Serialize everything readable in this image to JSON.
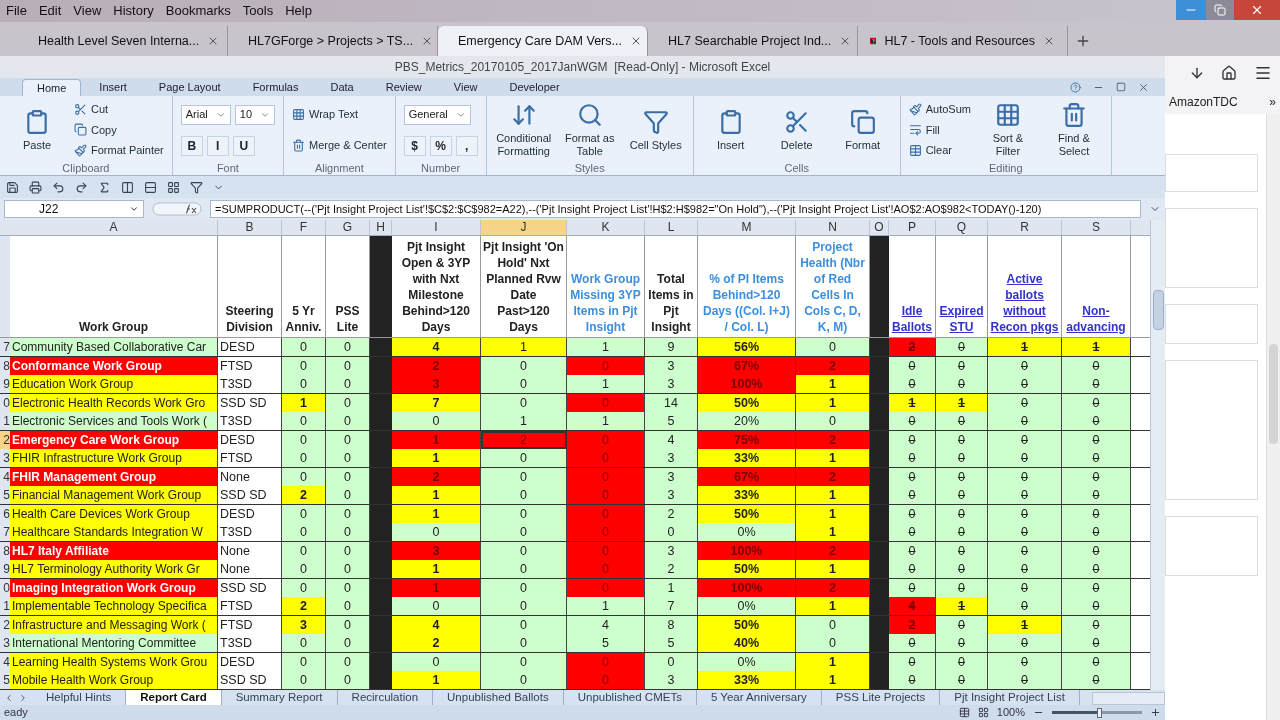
{
  "browser": {
    "menu": [
      "File",
      "Edit",
      "View",
      "History",
      "Bookmarks",
      "Tools",
      "Help"
    ],
    "tabs": [
      {
        "title": "Health Level Seven Interna...",
        "selected": false
      },
      {
        "title": "HL7GForge > Projects > TS...",
        "selected": false
      },
      {
        "title": "Emergency Care DAM Vers...",
        "selected": true
      },
      {
        "title": "HL7 Searchable Project Ind...",
        "selected": false
      },
      {
        "title": "HL7 - Tools and Resources",
        "selected": false
      }
    ],
    "bookmarks": [
      "AmazonTDC",
      "»"
    ]
  },
  "excel": {
    "title": "PBS_Metrics_20170105_2017JanWGM  [Read-Only] - Microsoft Excel",
    "ribbon_tabs": [
      {
        "label": "Home",
        "selected": true
      },
      {
        "label": "Insert",
        "selected": false
      },
      {
        "label": "Page Layout",
        "selected": false
      },
      {
        "label": "Formulas",
        "selected": false
      },
      {
        "label": "Data",
        "selected": false
      },
      {
        "label": "Review",
        "selected": false
      },
      {
        "label": "View",
        "selected": false
      },
      {
        "label": "Developer",
        "selected": false
      }
    ],
    "ribbon_groups": [
      {
        "name": "Clipboard",
        "stacks": [
          [
            [
              {
                "kind": "large",
                "label": "Paste"
              }
            ]
          ],
          [
            [
              {
                "kind": "small",
                "label": "Cut"
              }
            ],
            [
              {
                "kind": "small",
                "label": "Copy"
              }
            ],
            [
              {
                "kind": "small",
                "label": "Format Painter"
              }
            ]
          ]
        ]
      },
      {
        "name": "Font",
        "stacks": [
          [
            [
              {
                "kind": "field",
                "label": "Arial"
              },
              {
                "kind": "field",
                "label": "10"
              }
            ],
            [
              {
                "kind": "glyph",
                "label": "B"
              },
              {
                "kind": "glyph",
                "label": "I"
              },
              {
                "kind": "glyph",
                "label": "U"
              }
            ]
          ]
        ]
      },
      {
        "name": "Alignment",
        "stacks": [
          [
            [
              {
                "kind": "small",
                "label": "Wrap Text"
              }
            ],
            [
              {
                "kind": "small",
                "label": "Merge & Center"
              }
            ]
          ]
        ]
      },
      {
        "name": "Number",
        "stacks": [
          [
            [
              {
                "kind": "field",
                "label": "General"
              }
            ],
            [
              {
                "kind": "glyph",
                "label": "$"
              },
              {
                "kind": "glyph",
                "label": "%"
              },
              {
                "kind": "glyph",
                "label": ","
              }
            ]
          ]
        ]
      },
      {
        "name": "Styles",
        "stacks": [
          [
            [
              {
                "kind": "large",
                "label": "Conditional Formatting"
              }
            ]
          ],
          [
            [
              {
                "kind": "large",
                "label": "Format as Table"
              }
            ]
          ],
          [
            [
              {
                "kind": "large",
                "label": "Cell Styles"
              }
            ]
          ]
        ]
      },
      {
        "name": "Cells",
        "stacks": [
          [
            [
              {
                "kind": "large",
                "label": "Insert"
              }
            ]
          ],
          [
            [
              {
                "kind": "large",
                "label": "Delete"
              }
            ]
          ],
          [
            [
              {
                "kind": "large",
                "label": "Format"
              }
            ]
          ]
        ]
      },
      {
        "name": "Editing",
        "stacks": [
          [
            [
              {
                "kind": "small",
                "label": "AutoSum"
              }
            ],
            [
              {
                "kind": "small",
                "label": "Fill"
              }
            ],
            [
              {
                "kind": "small",
                "label": "Clear"
              }
            ]
          ],
          [
            [
              {
                "kind": "large",
                "label": "Sort & Filter"
              }
            ]
          ],
          [
            [
              {
                "kind": "large",
                "label": "Find & Select"
              }
            ]
          ]
        ]
      }
    ],
    "name_box": "J22",
    "formula": "=SUMPRODUCT(--('Pjt Insight Project List'!$C$2:$C$982=A22),--('Pjt Insight Project List'!H$2:H$982=\"On Hold\"),--('Pjt Insight Project List'!AO$2:AO$982<TODAY()-120)",
    "columns": [
      {
        "letter": "A",
        "heading": "Work Group",
        "kind": "plain",
        "selected": false
      },
      {
        "letter": "B",
        "heading": "Steering Division",
        "kind": "plain",
        "selected": false
      },
      {
        "letter": "F",
        "heading": "5 Yr Anniv.",
        "kind": "plain",
        "selected": false
      },
      {
        "letter": "G",
        "heading": "PSS Lite",
        "kind": "plain",
        "selected": false
      },
      {
        "letter": "H",
        "kind": "separator",
        "selected": false
      },
      {
        "letter": "I",
        "heading": "Pjt Insight Open & 3YP with Nxt Milestone Behind>120 Days",
        "kind": "plain",
        "selected": false
      },
      {
        "letter": "J",
        "heading": "Pjt Insight 'On Hold' Nxt Planned Rvw Date Past>120 Days",
        "kind": "plain",
        "selected": true
      },
      {
        "letter": "K",
        "heading": "Work Group Missing 3YP Items in Pjt Insight",
        "kind": "blue",
        "selected": false
      },
      {
        "letter": "L",
        "heading": "Total Items in Pjt Insight",
        "kind": "plain",
        "selected": false
      },
      {
        "letter": "M",
        "heading": "% of PI Items Behind>120 Days ((Col. I+J) / Col. L)",
        "kind": "blue",
        "selected": false
      },
      {
        "letter": "N",
        "heading": "Project Health (Nbr of Red Cells In Cols C, D, K, M)",
        "kind": "blue",
        "selected": false
      },
      {
        "letter": "O",
        "kind": "separator",
        "selected": false
      },
      {
        "letter": "P",
        "heading": "Idle Ballots",
        "kind": "struck",
        "selected": false
      },
      {
        "letter": "Q",
        "heading": "Expired STU",
        "kind": "struck",
        "selected": false
      },
      {
        "letter": "R",
        "heading": "Active ballots without Recon pkgs",
        "kind": "struck",
        "selected": false
      },
      {
        "letter": "S",
        "heading": "Non-advancing",
        "kind": "struck",
        "selected": false
      }
    ],
    "rows": [
      {
        "row": "7",
        "selected": false,
        "cells": [
          {
            "text": "Community Based Collaborative Car",
            "color": "#ccffcc"
          },
          {
            "text": "DESD",
            "color": "#ffffff"
          },
          {
            "text": "0",
            "color": "#ccffcc"
          },
          {
            "text": "0",
            "color": "#ccffcc"
          },
          {
            "color": "#222222"
          },
          {
            "text": "4",
            "color": "#ffff00"
          },
          {
            "text": "1",
            "color": "#ffff00"
          },
          {
            "text": "1",
            "color": "#ccffcc"
          },
          {
            "text": "9",
            "color": "#ccffcc"
          },
          {
            "text": "56%",
            "color": "#ffff00"
          },
          {
            "text": "0",
            "color": "#ccffcc"
          },
          {
            "color": "#222222"
          },
          {
            "text": "2",
            "color": "#ff0000"
          },
          {
            "text": "0",
            "color": "#ccffcc"
          },
          {
            "text": "1",
            "color": "#ffff00"
          },
          {
            "text": "1",
            "color": "#ffff00"
          }
        ]
      },
      {
        "row": "8",
        "selected": false,
        "cells": [
          {
            "text": "Conformance Work Group",
            "color": "#ff0000"
          },
          {
            "text": "FTSD",
            "color": "#ffffff"
          },
          {
            "text": "0",
            "color": "#ccffcc"
          },
          {
            "text": "0",
            "color": "#ccffcc"
          },
          {
            "color": "#222222"
          },
          {
            "text": "2",
            "color": "#ff0000"
          },
          {
            "text": "0",
            "color": "#ccffcc"
          },
          {
            "text": "0",
            "color": "#ff0000"
          },
          {
            "text": "3",
            "color": "#ccffcc"
          },
          {
            "text": "67%",
            "color": "#ff0000"
          },
          {
            "text": "2",
            "color": "#ff0000"
          },
          {
            "color": "#222222"
          },
          {
            "text": "0",
            "color": "#ccffcc"
          },
          {
            "text": "0",
            "color": "#ccffcc"
          },
          {
            "text": "0",
            "color": "#ccffcc"
          },
          {
            "text": "0",
            "color": "#ccffcc"
          }
        ]
      },
      {
        "row": "9",
        "selected": false,
        "cells": [
          {
            "text": "Education Work Group",
            "color": "#ffff00"
          },
          {
            "text": "T3SD",
            "color": "#ffffff"
          },
          {
            "text": "0",
            "color": "#ccffcc"
          },
          {
            "text": "0",
            "color": "#ccffcc"
          },
          {
            "color": "#222222"
          },
          {
            "text": "3",
            "color": "#ff0000"
          },
          {
            "text": "0",
            "color": "#ccffcc"
          },
          {
            "text": "1",
            "color": "#ccffcc"
          },
          {
            "text": "3",
            "color": "#ccffcc"
          },
          {
            "text": "100%",
            "color": "#ff0000"
          },
          {
            "text": "1",
            "color": "#ffff00"
          },
          {
            "color": "#222222"
          },
          {
            "text": "0",
            "color": "#ccffcc"
          },
          {
            "text": "0",
            "color": "#ccffcc"
          },
          {
            "text": "0",
            "color": "#ccffcc"
          },
          {
            "text": "0",
            "color": "#ccffcc"
          }
        ]
      },
      {
        "row": "0",
        "selected": false,
        "cells": [
          {
            "text": "Electronic Health Records Work Gro",
            "color": "#ffff00"
          },
          {
            "text": "SSD SD",
            "color": "#ffffff"
          },
          {
            "text": "1",
            "color": "#ffff00"
          },
          {
            "text": "0",
            "color": "#ccffcc"
          },
          {
            "color": "#222222"
          },
          {
            "text": "7",
            "color": "#ffff00"
          },
          {
            "text": "0",
            "color": "#ccffcc"
          },
          {
            "text": "0",
            "color": "#ff0000"
          },
          {
            "text": "14",
            "color": "#ccffcc"
          },
          {
            "text": "50%",
            "color": "#ffff00"
          },
          {
            "text": "1",
            "color": "#ffff00"
          },
          {
            "color": "#222222"
          },
          {
            "text": "1",
            "color": "#ffff00"
          },
          {
            "text": "1",
            "color": "#ffff00"
          },
          {
            "text": "0",
            "color": "#ccffcc"
          },
          {
            "text": "0",
            "color": "#ccffcc"
          }
        ]
      },
      {
        "row": "1",
        "selected": false,
        "cells": [
          {
            "text": "Electronic Services and Tools Work (",
            "color": "#ccffcc"
          },
          {
            "text": "T3SD",
            "color": "#ffffff"
          },
          {
            "text": "0",
            "color": "#ccffcc"
          },
          {
            "text": "0",
            "color": "#ccffcc"
          },
          {
            "color": "#222222"
          },
          {
            "text": "0",
            "color": "#ccffcc"
          },
          {
            "text": "1",
            "color": "#ccffcc"
          },
          {
            "text": "1",
            "color": "#ccffcc"
          },
          {
            "text": "5",
            "color": "#ccffcc"
          },
          {
            "text": "20%",
            "color": "#ccffcc"
          },
          {
            "text": "0",
            "color": "#ccffcc"
          },
          {
            "color": "#222222"
          },
          {
            "text": "0",
            "color": "#ccffcc"
          },
          {
            "text": "0",
            "color": "#ccffcc"
          },
          {
            "text": "0",
            "color": "#ccffcc"
          },
          {
            "text": "0",
            "color": "#ccffcc"
          }
        ]
      },
      {
        "row": "2",
        "selected": true,
        "cells": [
          {
            "text": "Emergency Care Work Group",
            "color": "#ff0000"
          },
          {
            "text": "DESD",
            "color": "#ffffff"
          },
          {
            "text": "0",
            "color": "#ccffcc"
          },
          {
            "text": "0",
            "color": "#ccffcc"
          },
          {
            "color": "#222222"
          },
          {
            "text": "1",
            "color": "#ff0000"
          },
          {
            "text": "2",
            "color": "#ff0000"
          },
          {
            "text": "0",
            "color": "#ff0000"
          },
          {
            "text": "4",
            "color": "#ccffcc"
          },
          {
            "text": "75%",
            "color": "#ff0000"
          },
          {
            "text": "2",
            "color": "#ff0000"
          },
          {
            "color": "#222222"
          },
          {
            "text": "0",
            "color": "#ccffcc"
          },
          {
            "text": "0",
            "color": "#ccffcc"
          },
          {
            "text": "0",
            "color": "#ccffcc"
          },
          {
            "text": "0",
            "color": "#ccffcc"
          }
        ]
      },
      {
        "row": "3",
        "selected": false,
        "cells": [
          {
            "text": "FHIR Infrastructure Work Group",
            "color": "#ffff00"
          },
          {
            "text": "FTSD",
            "color": "#ffffff"
          },
          {
            "text": "0",
            "color": "#ccffcc"
          },
          {
            "text": "0",
            "color": "#ccffcc"
          },
          {
            "color": "#222222"
          },
          {
            "text": "1",
            "color": "#ffff00"
          },
          {
            "text": "0",
            "color": "#ccffcc"
          },
          {
            "text": "0",
            "color": "#ff0000"
          },
          {
            "text": "3",
            "color": "#ccffcc"
          },
          {
            "text": "33%",
            "color": "#ffff00"
          },
          {
            "text": "1",
            "color": "#ffff00"
          },
          {
            "color": "#222222"
          },
          {
            "text": "0",
            "color": "#ccffcc"
          },
          {
            "text": "0",
            "color": "#ccffcc"
          },
          {
            "text": "0",
            "color": "#ccffcc"
          },
          {
            "text": "0",
            "color": "#ccffcc"
          }
        ]
      },
      {
        "row": "4",
        "selected": false,
        "cells": [
          {
            "text": "FHIR Management Group",
            "color": "#ff0000"
          },
          {
            "text": "None",
            "color": "#ffffff"
          },
          {
            "text": "0",
            "color": "#ccffcc"
          },
          {
            "text": "0",
            "color": "#ccffcc"
          },
          {
            "color": "#222222"
          },
          {
            "text": "2",
            "color": "#ff0000"
          },
          {
            "text": "0",
            "color": "#ccffcc"
          },
          {
            "text": "0",
            "color": "#ff0000"
          },
          {
            "text": "3",
            "color": "#ccffcc"
          },
          {
            "text": "67%",
            "color": "#ff0000"
          },
          {
            "text": "2",
            "color": "#ff0000"
          },
          {
            "color": "#222222"
          },
          {
            "text": "0",
            "color": "#ccffcc"
          },
          {
            "text": "0",
            "color": "#ccffcc"
          },
          {
            "text": "0",
            "color": "#ccffcc"
          },
          {
            "text": "0",
            "color": "#ccffcc"
          }
        ]
      },
      {
        "row": "5",
        "selected": false,
        "cells": [
          {
            "text": "Financial Management Work Group",
            "color": "#ffff00"
          },
          {
            "text": "SSD SD",
            "color": "#ffffff"
          },
          {
            "text": "2",
            "color": "#ffff00"
          },
          {
            "text": "0",
            "color": "#ccffcc"
          },
          {
            "color": "#222222"
          },
          {
            "text": "1",
            "color": "#ffff00"
          },
          {
            "text": "0",
            "color": "#ccffcc"
          },
          {
            "text": "0",
            "color": "#ff0000"
          },
          {
            "text": "3",
            "color": "#ccffcc"
          },
          {
            "text": "33%",
            "color": "#ffff00"
          },
          {
            "text": "1",
            "color": "#ffff00"
          },
          {
            "color": "#222222"
          },
          {
            "text": "0",
            "color": "#ccffcc"
          },
          {
            "text": "0",
            "color": "#ccffcc"
          },
          {
            "text": "0",
            "color": "#ccffcc"
          },
          {
            "text": "0",
            "color": "#ccffcc"
          }
        ]
      },
      {
        "row": "6",
        "selected": false,
        "cells": [
          {
            "text": "Health Care Devices Work Group",
            "color": "#ffff00"
          },
          {
            "text": "DESD",
            "color": "#ffffff"
          },
          {
            "text": "0",
            "color": "#ccffcc"
          },
          {
            "text": "0",
            "color": "#ccffcc"
          },
          {
            "color": "#222222"
          },
          {
            "text": "1",
            "color": "#ffff00"
          },
          {
            "text": "0",
            "color": "#ccffcc"
          },
          {
            "text": "0",
            "color": "#ff0000"
          },
          {
            "text": "2",
            "color": "#ccffcc"
          },
          {
            "text": "50%",
            "color": "#ffff00"
          },
          {
            "text": "1",
            "color": "#ffff00"
          },
          {
            "color": "#222222"
          },
          {
            "text": "0",
            "color": "#ccffcc"
          },
          {
            "text": "0",
            "color": "#ccffcc"
          },
          {
            "text": "0",
            "color": "#ccffcc"
          },
          {
            "text": "0",
            "color": "#ccffcc"
          }
        ]
      },
      {
        "row": "7",
        "selected": false,
        "cells": [
          {
            "text": "Healthcare Standards Integration W",
            "color": "#ffff00"
          },
          {
            "text": "T3SD",
            "color": "#ffffff"
          },
          {
            "text": "0",
            "color": "#ccffcc"
          },
          {
            "text": "0",
            "color": "#ccffcc"
          },
          {
            "color": "#222222"
          },
          {
            "text": "0",
            "color": "#ccffcc"
          },
          {
            "text": "0",
            "color": "#ccffcc"
          },
          {
            "text": "0",
            "color": "#ff0000"
          },
          {
            "text": "0",
            "color": "#ccffcc"
          },
          {
            "text": "0%",
            "color": "#ccffcc"
          },
          {
            "text": "1",
            "color": "#ffff00"
          },
          {
            "color": "#222222"
          },
          {
            "text": "0",
            "color": "#ccffcc"
          },
          {
            "text": "0",
            "color": "#ccffcc"
          },
          {
            "text": "0",
            "color": "#ccffcc"
          },
          {
            "text": "0",
            "color": "#ccffcc"
          }
        ]
      },
      {
        "row": "8",
        "selected": false,
        "cells": [
          {
            "text": "HL7 Italy Affiliate",
            "color": "#ff0000"
          },
          {
            "text": "None",
            "color": "#ffffff"
          },
          {
            "text": "0",
            "color": "#ccffcc"
          },
          {
            "text": "0",
            "color": "#ccffcc"
          },
          {
            "color": "#222222"
          },
          {
            "text": "3",
            "color": "#ff0000"
          },
          {
            "text": "0",
            "color": "#ccffcc"
          },
          {
            "text": "0",
            "color": "#ff0000"
          },
          {
            "text": "3",
            "color": "#ccffcc"
          },
          {
            "text": "100%",
            "color": "#ff0000"
          },
          {
            "text": "2",
            "color": "#ff0000"
          },
          {
            "color": "#222222"
          },
          {
            "text": "0",
            "color": "#ccffcc"
          },
          {
            "text": "0",
            "color": "#ccffcc"
          },
          {
            "text": "0",
            "color": "#ccffcc"
          },
          {
            "text": "0",
            "color": "#ccffcc"
          }
        ]
      },
      {
        "row": "9",
        "selected": false,
        "cells": [
          {
            "text": "HL7 Terminology Authority Work Gr",
            "color": "#ffff00"
          },
          {
            "text": "None",
            "color": "#ffffff"
          },
          {
            "text": "0",
            "color": "#ccffcc"
          },
          {
            "text": "0",
            "color": "#ccffcc"
          },
          {
            "color": "#222222"
          },
          {
            "text": "1",
            "color": "#ffff00"
          },
          {
            "text": "0",
            "color": "#ccffcc"
          },
          {
            "text": "0",
            "color": "#ff0000"
          },
          {
            "text": "2",
            "color": "#ccffcc"
          },
          {
            "text": "50%",
            "color": "#ffff00"
          },
          {
            "text": "1",
            "color": "#ffff00"
          },
          {
            "color": "#222222"
          },
          {
            "text": "0",
            "color": "#ccffcc"
          },
          {
            "text": "0",
            "color": "#ccffcc"
          },
          {
            "text": "0",
            "color": "#ccffcc"
          },
          {
            "text": "0",
            "color": "#ccffcc"
          }
        ]
      },
      {
        "row": "0",
        "selected": false,
        "cells": [
          {
            "text": "Imaging Integration Work Group",
            "color": "#ff0000"
          },
          {
            "text": "SSD SD",
            "color": "#ffffff"
          },
          {
            "text": "0",
            "color": "#ccffcc"
          },
          {
            "text": "0",
            "color": "#ccffcc"
          },
          {
            "color": "#222222"
          },
          {
            "text": "1",
            "color": "#ff0000"
          },
          {
            "text": "0",
            "color": "#ccffcc"
          },
          {
            "text": "0",
            "color": "#ff0000"
          },
          {
            "text": "1",
            "color": "#ccffcc"
          },
          {
            "text": "100%",
            "color": "#ff0000"
          },
          {
            "text": "2",
            "color": "#ff0000"
          },
          {
            "color": "#222222"
          },
          {
            "text": "0",
            "color": "#ccffcc"
          },
          {
            "text": "0",
            "color": "#ccffcc"
          },
          {
            "text": "0",
            "color": "#ccffcc"
          },
          {
            "text": "0",
            "color": "#ccffcc"
          }
        ]
      },
      {
        "row": "1",
        "selected": false,
        "cells": [
          {
            "text": "Implementable Technology Specifica",
            "color": "#ffff00"
          },
          {
            "text": "FTSD",
            "color": "#ffffff"
          },
          {
            "text": "2",
            "color": "#ffff00"
          },
          {
            "text": "0",
            "color": "#ccffcc"
          },
          {
            "color": "#222222"
          },
          {
            "text": "0",
            "color": "#ccffcc"
          },
          {
            "text": "0",
            "color": "#ccffcc"
          },
          {
            "text": "1",
            "color": "#ccffcc"
          },
          {
            "text": "7",
            "color": "#ccffcc"
          },
          {
            "text": "0%",
            "color": "#ccffcc"
          },
          {
            "text": "1",
            "color": "#ffff00"
          },
          {
            "color": "#222222"
          },
          {
            "text": "4",
            "color": "#ff0000"
          },
          {
            "text": "1",
            "color": "#ffff00"
          },
          {
            "text": "0",
            "color": "#ccffcc"
          },
          {
            "text": "0",
            "color": "#ccffcc"
          }
        ]
      },
      {
        "row": "2",
        "selected": false,
        "cells": [
          {
            "text": "Infrastructure and Messaging Work (",
            "color": "#ffff00"
          },
          {
            "text": "FTSD",
            "color": "#ffffff"
          },
          {
            "text": "3",
            "color": "#ffff00"
          },
          {
            "text": "0",
            "color": "#ccffcc"
          },
          {
            "color": "#222222"
          },
          {
            "text": "4",
            "color": "#ffff00"
          },
          {
            "text": "0",
            "color": "#ccffcc"
          },
          {
            "text": "4",
            "color": "#ccffcc"
          },
          {
            "text": "8",
            "color": "#ccffcc"
          },
          {
            "text": "50%",
            "color": "#ffff00"
          },
          {
            "text": "0",
            "color": "#ccffcc"
          },
          {
            "color": "#222222"
          },
          {
            "text": "2",
            "color": "#ff0000"
          },
          {
            "text": "0",
            "color": "#ccffcc"
          },
          {
            "text": "1",
            "color": "#ffff00"
          },
          {
            "text": "0",
            "color": "#ccffcc"
          }
        ]
      },
      {
        "row": "3",
        "selected": false,
        "cells": [
          {
            "text": "International Mentoring Committee",
            "color": "#ccffcc"
          },
          {
            "text": "T3SD",
            "color": "#ffffff"
          },
          {
            "text": "0",
            "color": "#ccffcc"
          },
          {
            "text": "0",
            "color": "#ccffcc"
          },
          {
            "color": "#222222"
          },
          {
            "text": "2",
            "color": "#ffff00"
          },
          {
            "text": "0",
            "color": "#ccffcc"
          },
          {
            "text": "5",
            "color": "#ccffcc"
          },
          {
            "text": "5",
            "color": "#ccffcc"
          },
          {
            "text": "40%",
            "color": "#ffff00"
          },
          {
            "text": "0",
            "color": "#ccffcc"
          },
          {
            "color": "#222222"
          },
          {
            "text": "0",
            "color": "#ccffcc"
          },
          {
            "text": "0",
            "color": "#ccffcc"
          },
          {
            "text": "0",
            "color": "#ccffcc"
          },
          {
            "text": "0",
            "color": "#ccffcc"
          }
        ]
      },
      {
        "row": "4",
        "selected": false,
        "cells": [
          {
            "text": "Learning Health Systems Work Grou",
            "color": "#ffff00"
          },
          {
            "text": "DESD",
            "color": "#ffffff"
          },
          {
            "text": "0",
            "color": "#ccffcc"
          },
          {
            "text": "0",
            "color": "#ccffcc"
          },
          {
            "color": "#222222"
          },
          {
            "text": "0",
            "color": "#ccffcc"
          },
          {
            "text": "0",
            "color": "#ccffcc"
          },
          {
            "text": "0",
            "color": "#ff0000"
          },
          {
            "text": "0",
            "color": "#ccffcc"
          },
          {
            "text": "0%",
            "color": "#ccffcc"
          },
          {
            "text": "1",
            "color": "#ffff00"
          },
          {
            "color": "#222222"
          },
          {
            "text": "0",
            "color": "#ccffcc"
          },
          {
            "text": "0",
            "color": "#ccffcc"
          },
          {
            "text": "0",
            "color": "#ccffcc"
          },
          {
            "text": "0",
            "color": "#ccffcc"
          }
        ]
      },
      {
        "row": "5",
        "selected": false,
        "cells": [
          {
            "text": "Mobile Health Work Group",
            "color": "#ffff00"
          },
          {
            "text": "SSD SD",
            "color": "#ffffff"
          },
          {
            "text": "0",
            "color": "#ccffcc"
          },
          {
            "text": "0",
            "color": "#ccffcc"
          },
          {
            "color": "#222222"
          },
          {
            "text": "1",
            "color": "#ffff00"
          },
          {
            "text": "0",
            "color": "#ccffcc"
          },
          {
            "text": "0",
            "color": "#ff0000"
          },
          {
            "text": "3",
            "color": "#ccffcc"
          },
          {
            "text": "33%",
            "color": "#ffff00"
          },
          {
            "text": "1",
            "color": "#ffff00"
          },
          {
            "color": "#222222"
          },
          {
            "text": "0",
            "color": "#ccffcc"
          },
          {
            "text": "0",
            "color": "#ccffcc"
          },
          {
            "text": "0",
            "color": "#ccffcc"
          },
          {
            "text": "0",
            "color": "#ccffcc"
          }
        ]
      }
    ],
    "sheet_tabs": [
      {
        "label": "Helpful Hints",
        "selected": false
      },
      {
        "label": "Report Card",
        "selected": true
      },
      {
        "label": "Summary Report",
        "selected": false
      },
      {
        "label": "Recirculation",
        "selected": false
      },
      {
        "label": "Unpublished Ballots",
        "selected": false
      },
      {
        "label": "Unpublished CMETs",
        "selected": false
      },
      {
        "label": "5 Year Anniversary",
        "selected": false
      },
      {
        "label": "PSS Lite Projects",
        "selected": false
      },
      {
        "label": "Pjt Insight Project List",
        "selected": false
      }
    ],
    "status": "eady",
    "zoom": "100%",
    "zoom_slider": {
      "level": 0.5
    }
  }
}
